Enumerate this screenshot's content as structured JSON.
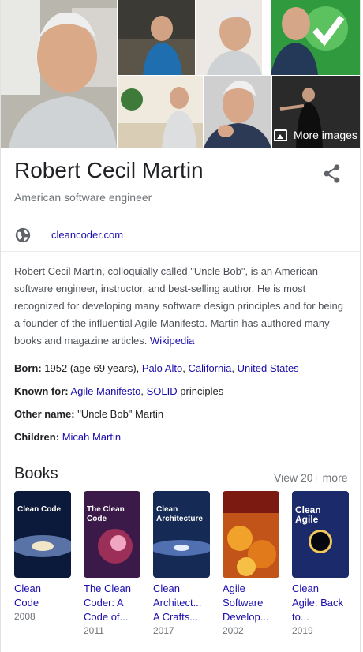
{
  "images": {
    "more_label": "More images"
  },
  "header": {
    "title": "Robert Cecil Martin",
    "subtitle": "American software engineer"
  },
  "website": {
    "label": "cleancoder.com"
  },
  "description": {
    "text": "Robert Cecil Martin, colloquially called \"Uncle Bob\", is an American software engineer, instructor, and best-selling author. He is most recognized for developing many software design principles and for being a founder of the influential Agile Manifesto. Martin has authored many books and magazine articles.",
    "source_link": "Wikipedia"
  },
  "facts": {
    "born": {
      "label": "Born:",
      "text": "1952 (age 69 years),",
      "links": [
        "Palo Alto",
        "California",
        "United States"
      ]
    },
    "known_for": {
      "label": "Known for:",
      "links": [
        "Agile Manifesto",
        "SOLID"
      ],
      "suffix": "principles"
    },
    "other_name": {
      "label": "Other name:",
      "text": "\"Uncle Bob\" Martin"
    },
    "children": {
      "label": "Children:",
      "link": "Micah Martin"
    }
  },
  "books": {
    "heading": "Books",
    "view_more": "View 20+ more",
    "items": [
      {
        "title_lines": [
          "Clean",
          "Code"
        ],
        "year": "2008",
        "cover_text": "Clean Code",
        "color": "#0b1a3a"
      },
      {
        "title_lines": [
          "The Clean",
          "Coder: A",
          "Code of..."
        ],
        "year": "2011",
        "cover_text": "The Clean Code",
        "color": "#3b1a4a"
      },
      {
        "title_lines": [
          "Clean",
          "Architect...",
          "A Crafts..."
        ],
        "year": "2017",
        "cover_text": "Clean Architecture",
        "color": "#152a55"
      },
      {
        "title_lines": [
          "Agile",
          "Software",
          "Develop..."
        ],
        "year": "2002",
        "cover_text": "",
        "color": "#c2541a"
      },
      {
        "title_lines": [
          "Clean",
          "Agile: Back",
          "to..."
        ],
        "year": "2019",
        "cover_text": "Clean Agile",
        "color": "#1b2a6b"
      }
    ]
  },
  "colors": {
    "link": "#1a0dab",
    "muted": "#70757a",
    "text": "#202124"
  }
}
